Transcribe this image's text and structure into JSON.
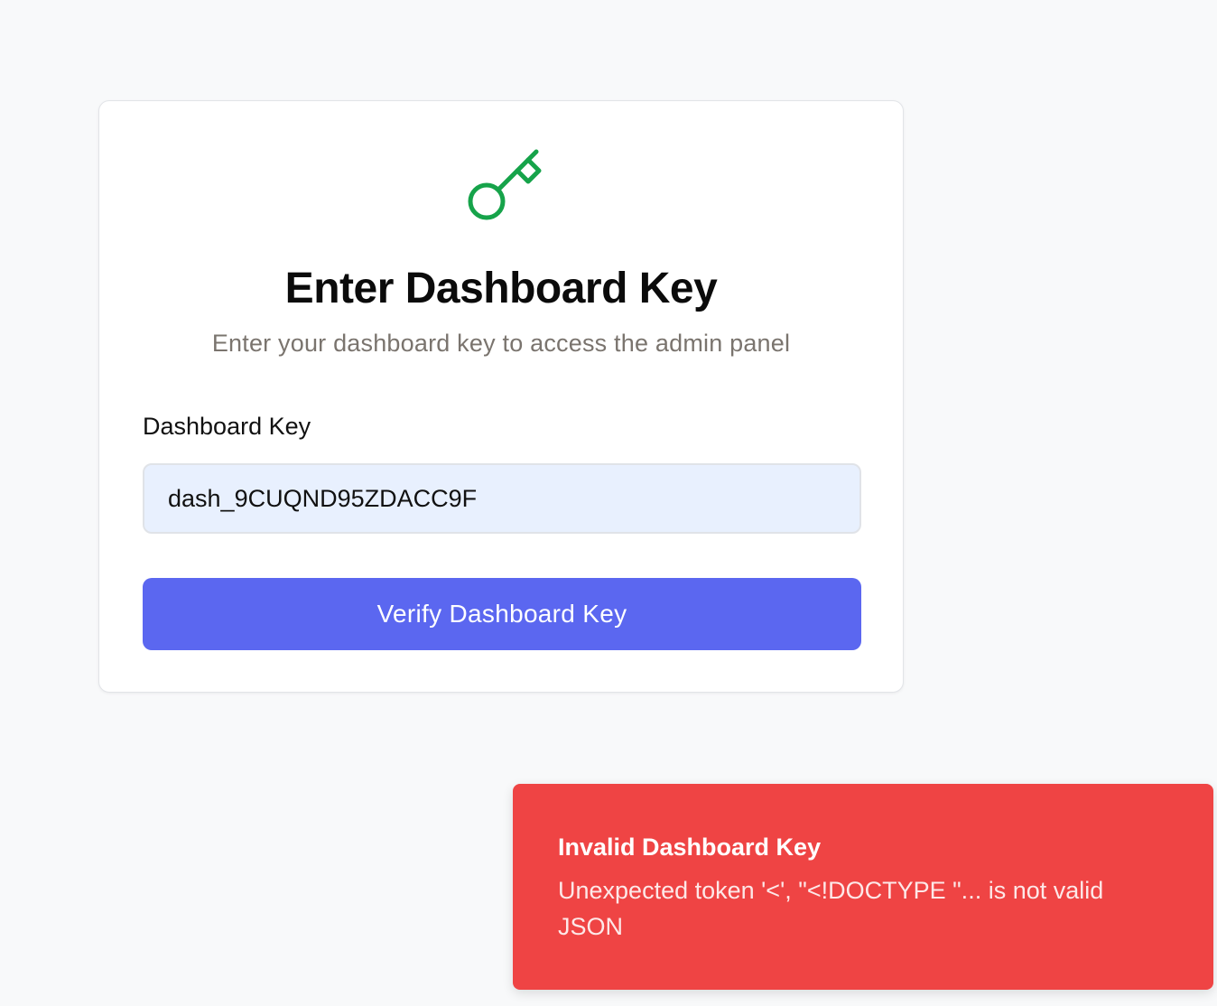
{
  "card": {
    "icon": "key-icon",
    "title": "Enter Dashboard Key",
    "subtitle": "Enter your dashboard key to access the admin panel",
    "field_label": "Dashboard Key",
    "input_value": "dash_9CUQND95ZDACC9F",
    "button_label": "Verify Dashboard Key"
  },
  "toast": {
    "title": "Invalid Dashboard Key",
    "message": "Unexpected token '<', \"<!DOCTYPE \"... is not valid JSON"
  },
  "colors": {
    "accent": "#5b67f0",
    "icon": "#16a34a",
    "error": "#ef4444",
    "input_bg": "#e8f0fe"
  }
}
